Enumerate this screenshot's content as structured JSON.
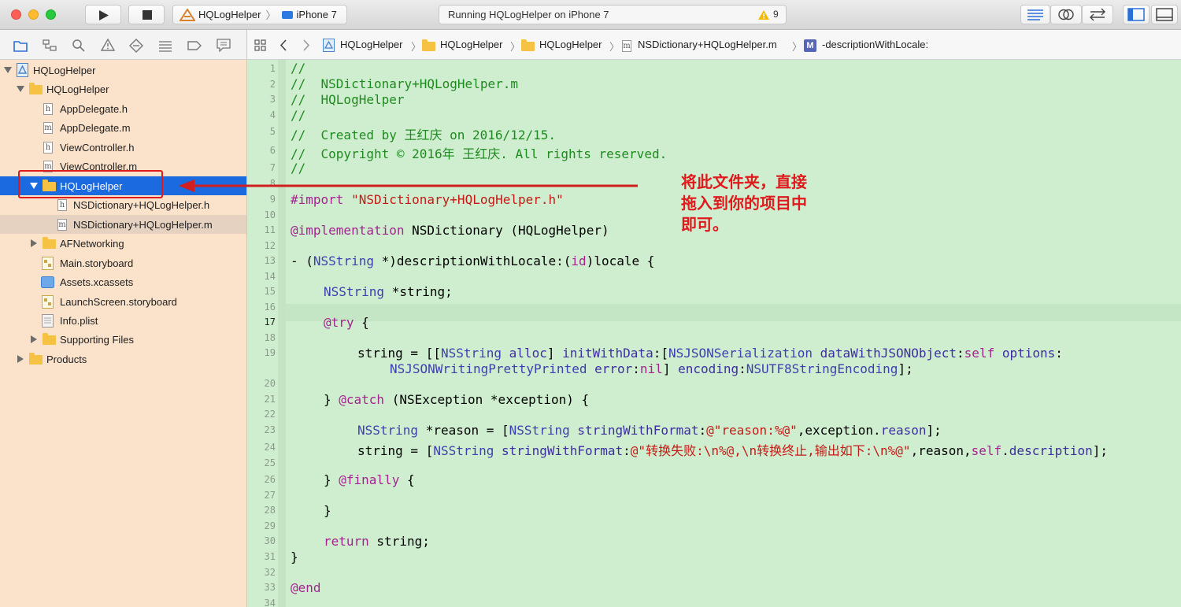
{
  "toolbar": {
    "scheme": "HQLogHelper",
    "device": "iPhone 7",
    "status": "Running HQLogHelper on iPhone 7",
    "warning_count": "9"
  },
  "navigator": {
    "items": [
      {
        "label": "HQLogHelper",
        "type": "project",
        "expanded": true
      },
      {
        "label": "HQLogHelper",
        "type": "folder",
        "expanded": true
      },
      {
        "label": "AppDelegate.h",
        "type": "h"
      },
      {
        "label": "AppDelegate.m",
        "type": "m"
      },
      {
        "label": "ViewController.h",
        "type": "h"
      },
      {
        "label": "ViewController.m",
        "type": "m"
      },
      {
        "label": "HQLogHelper",
        "type": "folder",
        "expanded": true,
        "selected": true
      },
      {
        "label": "NSDictionary+HQLogHelper.h",
        "type": "h"
      },
      {
        "label": "NSDictionary+HQLogHelper.m",
        "type": "m"
      },
      {
        "label": "AFNetworking",
        "type": "folder",
        "expanded": false
      },
      {
        "label": "Main.storyboard",
        "type": "storyboard"
      },
      {
        "label": "Assets.xcassets",
        "type": "assets"
      },
      {
        "label": "LaunchScreen.storyboard",
        "type": "storyboard"
      },
      {
        "label": "Info.plist",
        "type": "plist"
      },
      {
        "label": "Supporting Files",
        "type": "folder",
        "expanded": false
      },
      {
        "label": "Products",
        "type": "folder",
        "expanded": false
      }
    ]
  },
  "jumpbar": {
    "crumbs": [
      "HQLogHelper",
      "HQLogHelper",
      "HQLogHelper",
      "NSDictionary+HQLogHelper.m",
      "-descriptionWithLocale:"
    ]
  },
  "annotation": "将此文件夹，直接\n拖入到你的项目中\n即可。",
  "code": {
    "line_numbers": [
      "1",
      "2",
      "3",
      "4",
      "5",
      "6",
      "7",
      "8",
      "9",
      "10",
      "11",
      "12",
      "13",
      "14",
      "15",
      "16",
      "17",
      "18",
      "19",
      "20",
      "21",
      "22",
      "23",
      "24",
      "25",
      "26",
      "27",
      "28",
      "29",
      "30",
      "31",
      "32",
      "33",
      "34"
    ],
    "l1": "//",
    "l2": "//  NSDictionary+HQLogHelper.m",
    "l3": "//  HQLogHelper",
    "l4": "//",
    "l5": "//  Created by 王红庆 on 2016/12/15.",
    "l6": "//  Copyright © 2016年 王红庆. All rights reserved.",
    "l7": "//",
    "import_kw": "#import",
    "import_str": " \"NSDictionary+HQLogHelper.h\"",
    "impl_kw": "@implementation",
    "impl_rest": " NSDictionary (HQLogHelper)",
    "l13_a": "- (",
    "l13_ty": "NSString",
    "l13_b": " *)descriptionWithLocale:(",
    "l13_id": "id",
    "l13_c": ")locale {",
    "l15_ty": "NSString",
    "l15_rest": " *string;",
    "try_kw": "@try",
    "try_rest": " {",
    "l19_a": "string = [[",
    "l19_ty": "NSString",
    "l19_b": " ",
    "l19_me": "alloc",
    "l19_c": "] ",
    "l19_me2": "initWithData",
    "l19_d": ":[",
    "l19_ty2": "NSJSONSerialization",
    "l19_e": " ",
    "l19_me3": "dataWithJSONObject",
    "l19_f": ":",
    "l19_self": "self",
    "l19_g": " ",
    "l19_me4": "options",
    "l19_h": ":",
    "l19w_ty": "NSJSONWritingPrettyPrinted",
    "l19w_a": " ",
    "l19w_me": "error",
    "l19w_b": ":",
    "l19w_nil": "nil",
    "l19w_c": "] ",
    "l19w_me2": "encoding",
    "l19w_d": ":",
    "l19w_ty2": "NSUTF8StringEncoding",
    "l19w_e": "];",
    "l21_a": "} ",
    "catch_kw": "@catch",
    "l21_b": " (NSException *exception) {",
    "l23_ty": "NSString",
    "l23_a": " *reason = [",
    "l23_ty2": "NSString",
    "l23_b": " ",
    "l23_me": "stringWithFormat",
    "l23_c": ":",
    "l23_str": "@\"reason:%@\"",
    "l23_d": ",exception.",
    "l23_me2": "reason",
    "l23_e": "];",
    "l24_a": "string = [",
    "l24_ty": "NSString",
    "l24_b": " ",
    "l24_me": "stringWithFormat",
    "l24_c": ":",
    "l24_str": "@\"转换失败:\\n%@,\\n转换终止,输出如下:\\n%@\"",
    "l24_d": ",reason,",
    "l24_self": "self",
    "l24_e": ".",
    "l24_me2": "description",
    "l24_f": "];",
    "l26_a": "} ",
    "finally_kw": "@finally",
    "l26_b": " {",
    "l28": "}",
    "return_kw": "return",
    "return_rest": " string;",
    "l31": "}",
    "end_kw": "@end"
  },
  "colors": {
    "selection": "#1b6ae0",
    "annotation": "#e0191d",
    "comment": "#1f8a1f",
    "keyword": "#a4238f",
    "string": "#c41a16"
  }
}
